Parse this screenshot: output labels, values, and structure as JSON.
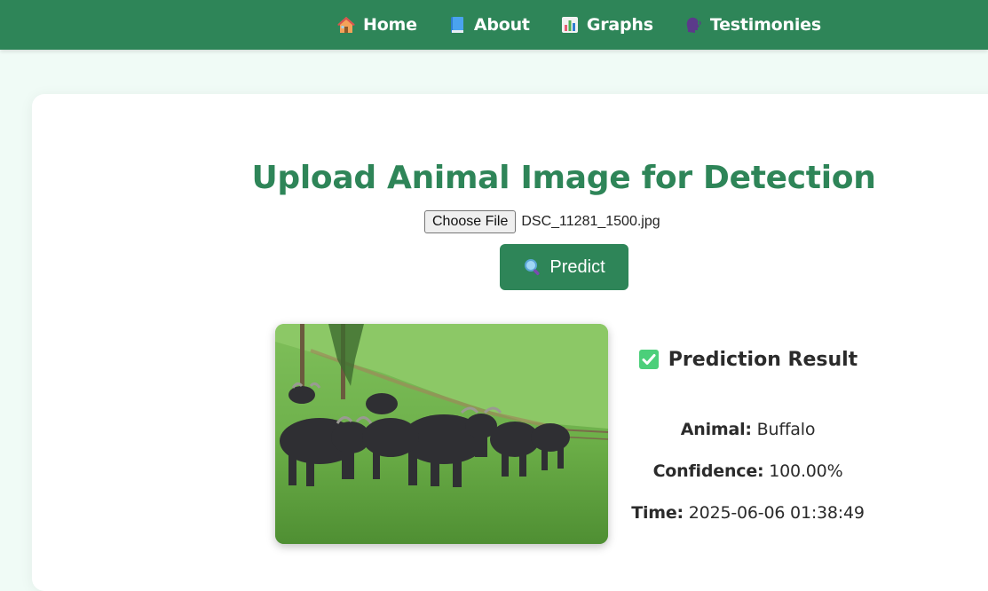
{
  "nav": {
    "items": [
      {
        "label": "Home",
        "icon": "house-icon"
      },
      {
        "label": "About",
        "icon": "book-icon"
      },
      {
        "label": "Graphs",
        "icon": "bar-chart-icon"
      },
      {
        "label": "Testimonies",
        "icon": "speaking-head-icon"
      }
    ]
  },
  "upload": {
    "title": "Upload Animal Image for Detection",
    "choose_file_label": "Choose File",
    "file_name": "DSC_11281_1500.jpg",
    "predict_label": "Predict",
    "predict_icon": "magnifier-icon"
  },
  "result": {
    "icon": "check-mark-button-icon",
    "title": "Prediction Result",
    "animal_label": "Animal:",
    "animal_value": "Buffalo",
    "confidence_label": "Confidence:",
    "confidence_value": "100.00%",
    "time_label": "Time:",
    "time_value": "2025-06-06 01:38:49"
  },
  "colors": {
    "primary": "#2e8558",
    "page_bg": "#f0fbf6",
    "card_bg": "#ffffff",
    "text": "#2b2b2b"
  }
}
